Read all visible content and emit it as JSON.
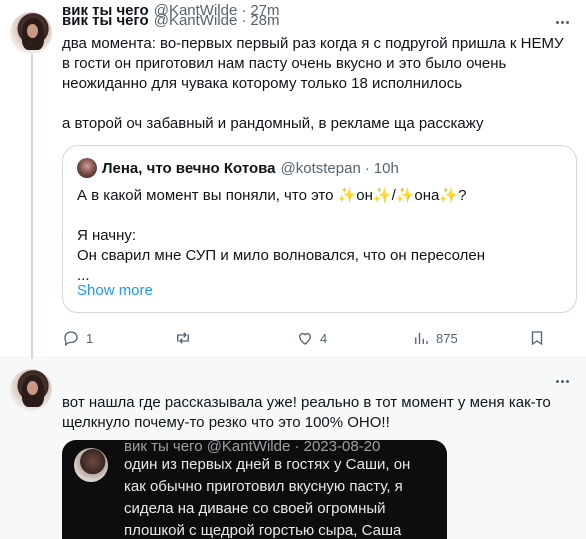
{
  "tweet1": {
    "name": "вик ты чего",
    "handle": "@KantWilde",
    "dot": "·",
    "time": "28m",
    "text": "два момента: во-первых первый раз когда я с подругой пришла к НЕМУ в гости он приготовил нам пасту очень вкусно и это было очень неожиданно для чувака которому только 18 исполнилось\n\nа второй оч забавный и рандомный, в рекламе ща расскажу",
    "quote": {
      "name": "Лена, что вечно Котова",
      "handle": "@kotstepan",
      "dot": "·",
      "time": "10h",
      "text": "А в какой момент вы поняли, что это ✨он✨/✨она✨?\n\nЯ начну:\nОн сварил мне СУП и мило волновался, что он пересолен\n...",
      "show_more": "Show more"
    },
    "actions": {
      "reply_count": "1",
      "retweet_count": "",
      "like_count": "4",
      "views_count": "875"
    }
  },
  "tweet2": {
    "name": "вик ты чего",
    "handle": "@KantWilde",
    "dot": "·",
    "time": "27m",
    "text": "вот нашла где рассказывала уже! реально в тот момент у меня как-то щелкнуло почему-то резко что это 100% ОНО!!",
    "embedded_screenshot": {
      "header": "вик ты чего @KantWilde · 2023-08-20",
      "text": "один из первых дней в гостях у Саши, он как обычно приготовил вкусную пасту, я сидела на диване со своей огромный плошкой с щедрой горстью сыра, Саша сидел на полу, его мама рядом на кресле"
    }
  },
  "colors": {
    "accent": "#1d9bf0",
    "text": "#0f1419",
    "muted": "#536471",
    "border": "#cfd9de",
    "hover_bg": "#f7f9f9"
  },
  "icons": [
    "more-icon",
    "reply-icon",
    "retweet-icon",
    "like-icon",
    "views-icon",
    "bookmark-icon"
  ]
}
